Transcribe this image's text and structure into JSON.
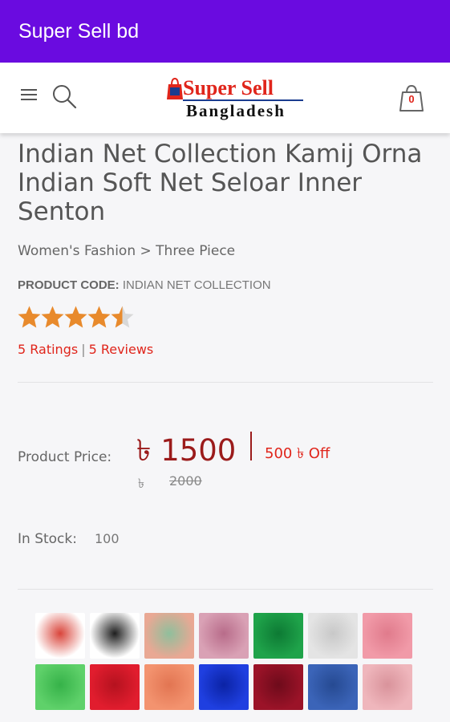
{
  "appbar": {
    "title": "Super Sell bd",
    "color": "#6a0be0"
  },
  "header": {
    "menu_icon": "hamburger-menu-icon",
    "search_icon": "search-icon",
    "logo": {
      "top": "Super Sell",
      "bottom": "Bangladesh"
    },
    "cart": {
      "icon": "shopping-bag-icon",
      "count": "0"
    }
  },
  "product": {
    "title": "Indian Net Collection Kamij Orna Indian Soft Net Seloar Inner Senton",
    "breadcrumb": "Women's Fashion > Three Piece",
    "code_label": "PRODUCT CODE:",
    "code_value": "INDIAN NET COLLECTION",
    "rating": 4.5,
    "ratings_text": "5 Ratings",
    "ratings_sep": "|",
    "reviews_text": "5 Reviews",
    "price_label": "Product Price:",
    "price_value": "৳ 1500",
    "price_sep": "|",
    "discount_text": "500 ৳ Off",
    "old_price_currency": "৳",
    "old_price": "2000",
    "stock_label": "In Stock:",
    "stock_value": "100"
  },
  "thumbnails": [
    {
      "name": "red-dress-thumb",
      "colors": [
        "#ffffff",
        "#d9453b"
      ]
    },
    {
      "name": "black-dress-thumb",
      "colors": [
        "#ffffff",
        "#1e1e1e"
      ]
    },
    {
      "name": "peach-set-thumb",
      "colors": [
        "#e9a894",
        "#8fbf9c"
      ]
    },
    {
      "name": "pink-model-thumb",
      "colors": [
        "#d9a1b5",
        "#b86c8a"
      ]
    },
    {
      "name": "green-fabric-thumb",
      "colors": [
        "#1fa34a",
        "#0d7a34"
      ]
    },
    {
      "name": "white-fabric-thumb",
      "colors": [
        "#e4e4e4",
        "#c8c8c8"
      ]
    },
    {
      "name": "pink-fabric-thumb",
      "colors": [
        "#f19aa8",
        "#e07b8c"
      ]
    },
    {
      "name": "lime-fabric-thumb",
      "colors": [
        "#5fd16a",
        "#36b249"
      ]
    },
    {
      "name": "red-fabric-thumb",
      "colors": [
        "#e11d2e",
        "#b5121f"
      ]
    },
    {
      "name": "salmon-fabric-thumb",
      "colors": [
        "#f3936f",
        "#e27552"
      ]
    },
    {
      "name": "blue-fabric-thumb",
      "colors": [
        "#1f3fe0",
        "#0b23a5"
      ]
    },
    {
      "name": "maroon-fabric-thumb",
      "colors": [
        "#9b1328",
        "#6e0b1b"
      ]
    },
    {
      "name": "navy-fabric-thumb",
      "colors": [
        "#3b64b8",
        "#264a92"
      ]
    },
    {
      "name": "rose-fabric-thumb",
      "colors": [
        "#efb6bc",
        "#d9939b"
      ]
    }
  ],
  "colors": {
    "accent": "#6a0be0",
    "price": "#9b1b1b",
    "link": "#e0251b",
    "star": "#e88a2c"
  }
}
